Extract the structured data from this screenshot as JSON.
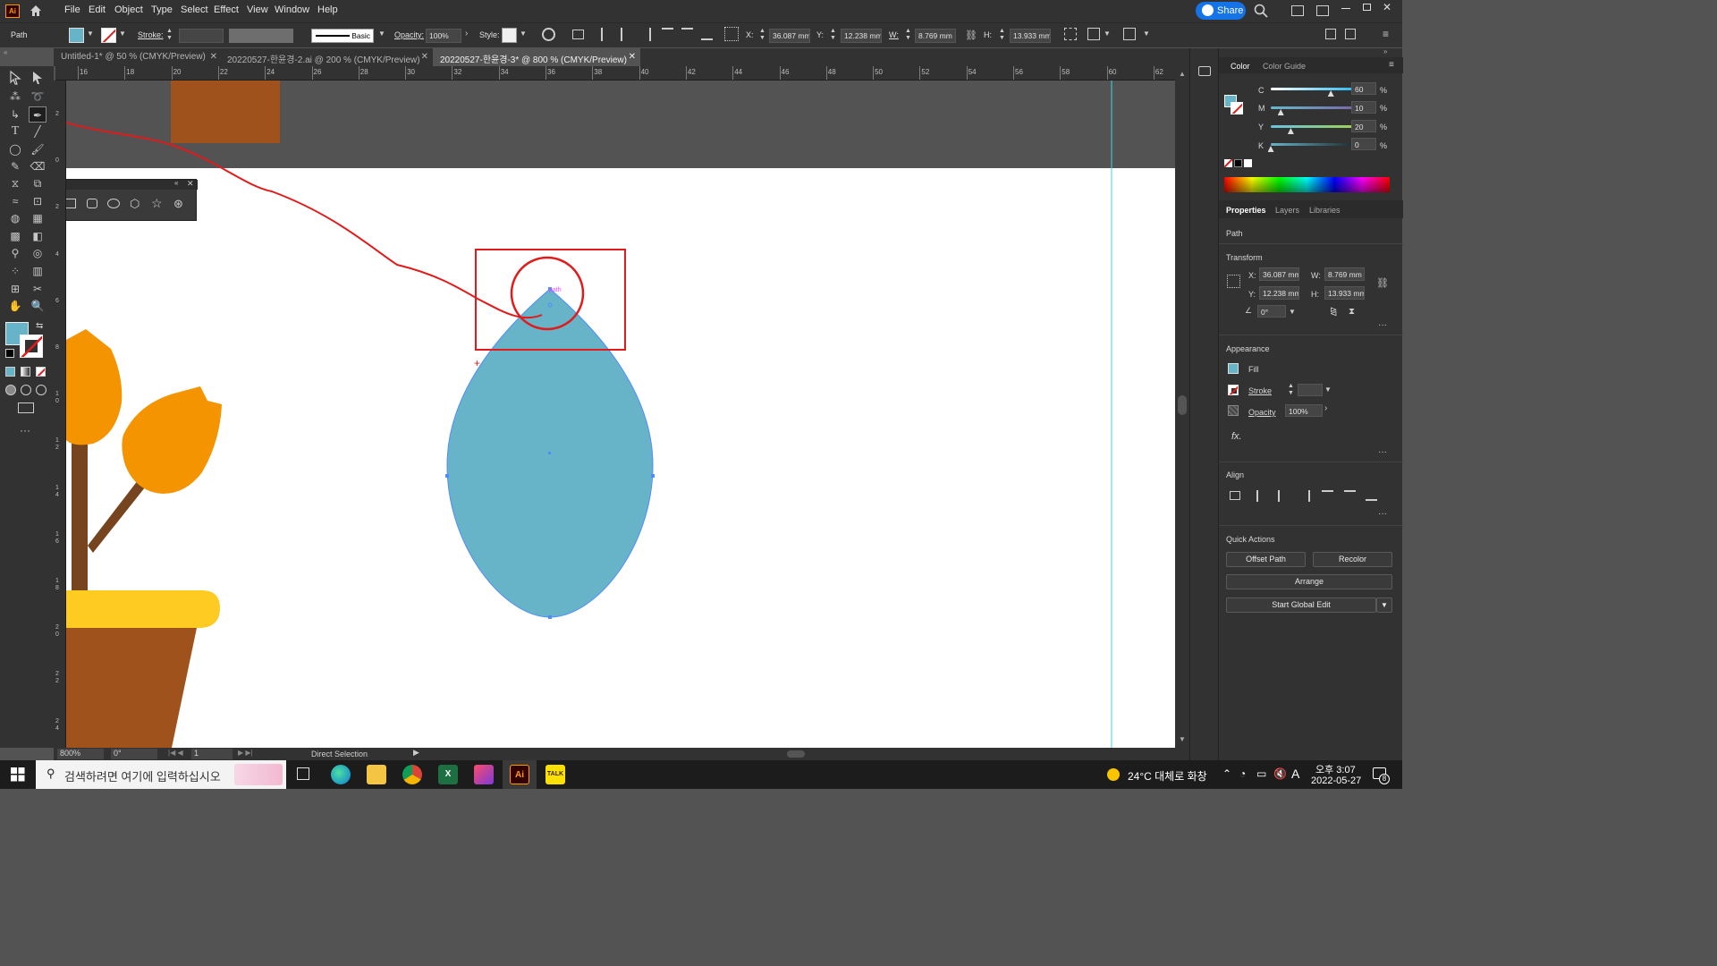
{
  "menubar": {
    "app_logo": "Ai",
    "items": [
      "File",
      "Edit",
      "Object",
      "Type",
      "Select",
      "Effect",
      "View",
      "Window",
      "Help"
    ],
    "share_label": "Share"
  },
  "control": {
    "object_type": "Path",
    "stroke_label": "Stroke:",
    "brush_label": "Basic",
    "opacity_label": "Opacity:",
    "opacity_value": "100%",
    "style_label": "Style:",
    "x_label": "X:",
    "x_value": "36.087 mm",
    "y_label": "Y:",
    "y_value": "12.238 mm",
    "w_label": "W:",
    "w_value": "8.769 mm",
    "h_label": "H:",
    "h_value": "13.933 mm"
  },
  "tabs": [
    {
      "label": "Untitled-1* @ 50 % (CMYK/Preview)"
    },
    {
      "label": "20220527-한윤경-2.ai @ 200 % (CMYK/Preview)"
    },
    {
      "label": "20220527-한윤경-3* @ 800 % (CMYK/Preview)"
    }
  ],
  "ruler": {
    "top_ticks": [
      "16",
      "18",
      "20",
      "22",
      "24",
      "26",
      "28",
      "30",
      "32",
      "34",
      "36",
      "38",
      "40",
      "42",
      "44",
      "46",
      "48",
      "50",
      "52",
      "54",
      "56",
      "58",
      "60",
      "62"
    ],
    "left_ticks": [
      "2",
      "0",
      "2",
      "4",
      "6",
      "8",
      "1\n0",
      "1\n2",
      "1\n4",
      "1\n6",
      "1\n8",
      "2\n0",
      "2\n2",
      "2\n4"
    ]
  },
  "canvas": {
    "anchor_hint": "path",
    "colors": {
      "fill": "#67b3c8",
      "brown": "#a0521d",
      "orange": "#f39400",
      "yellow": "#fecb22",
      "stem": "#76441e",
      "annotation": "#e11b1b"
    }
  },
  "status": {
    "zoom": "800%",
    "rotation": "0°",
    "artboard": "1",
    "tool": "Direct Selection"
  },
  "color_panel": {
    "tabs": [
      "Color",
      "Color Guide"
    ],
    "channels": [
      {
        "label": "C",
        "value": "60",
        "unit": "%",
        "level": 0.6
      },
      {
        "label": "M",
        "value": "10",
        "unit": "%",
        "level": 0.1
      },
      {
        "label": "Y",
        "value": "20",
        "unit": "%",
        "level": 0.2
      },
      {
        "label": "K",
        "value": "0",
        "unit": "%",
        "level": 0.0
      }
    ]
  },
  "properties": {
    "tabs": [
      "Properties",
      "Layers",
      "Libraries"
    ],
    "object_type": "Path",
    "transform_title": "Transform",
    "x_label": "X:",
    "x_value": "36.087 mm",
    "y_label": "Y:",
    "y_value": "12.238 mm",
    "w_label": "W:",
    "w_value": "8.769 mm",
    "h_label": "H:",
    "h_value": "13.933 mm",
    "angle_value": "0°",
    "appearance_title": "Appearance",
    "fill_label": "Fill",
    "stroke_label": "Stroke",
    "opacity_label": "Opacity",
    "opacity_value": "100%",
    "fx_label": "fx.",
    "align_title": "Align",
    "quick_actions_title": "Quick Actions",
    "offset_path": "Offset Path",
    "recolor": "Recolor",
    "arrange": "Arrange",
    "start_global_edit": "Start Global Edit"
  },
  "taskbar": {
    "search_placeholder": "검색하려면 여기에 입력하십시오",
    "weather": "24°C  대체로 화창",
    "ime": "A",
    "time": "오후 3:07",
    "date": "2022-05-27",
    "notification_count": "8"
  }
}
